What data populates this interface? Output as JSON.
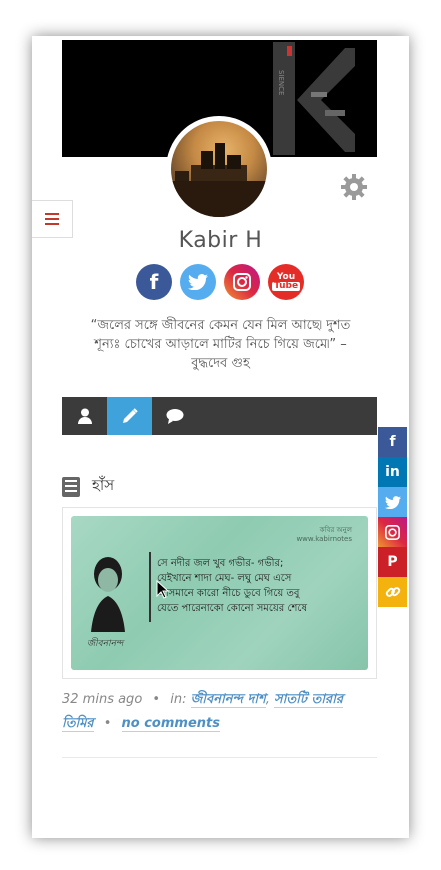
{
  "profile": {
    "name": "Kabir H",
    "quote": "“জলের সঙ্গে জীবনের কেমন যেন মিল আছে৷ দুশত শূন্যঃ চোখের আড়ালে মাটির নিচে গিয়ে জমে৷” – বুদ্ধদেব গুহ"
  },
  "socials": [
    {
      "name": "facebook-icon",
      "color": "#3b5998",
      "glyph": "f"
    },
    {
      "name": "twitter-icon",
      "color": "#55acee",
      "glyph": "t"
    },
    {
      "name": "instagram-icon",
      "color": "#c13584",
      "glyph": "◎"
    },
    {
      "name": "youtube-icon",
      "color": "#e52d27",
      "glyph": "You Tube"
    }
  ],
  "tabs": [
    {
      "name": "tab-profile",
      "icon": "user-icon"
    },
    {
      "name": "tab-posts",
      "icon": "pencil-icon",
      "active": true
    },
    {
      "name": "tab-comments",
      "icon": "comment-icon"
    }
  ],
  "post": {
    "title": "হাঁস",
    "image_text": {
      "lines": [
        "সে নদীর জল খুব গভীর- গভীর;",
        "যেইখানে শাদা মেঘ- লঘু মেঘ এসে",
        "আসমানে কারো নীচে ডুবে গিয়ে তবু",
        "যেতে পারেনাকো কোনো সময়ের শেষে"
      ],
      "poet": "জীবনানন্দ",
      "watermark": "কবির অনুল\nwww.kabirnotes"
    },
    "time": "32 mins ago",
    "in_label": "in:",
    "categories": [
      "জীবনানন্দ দাশ",
      "সাতটি তারার তিমির"
    ],
    "comments": "no comments"
  },
  "share_bar": [
    {
      "name": "facebook-share-icon",
      "color": "#3b5998",
      "glyph": "f"
    },
    {
      "name": "linkedin-share-icon",
      "color": "#0077b5",
      "glyph": "in"
    },
    {
      "name": "twitter-share-icon",
      "color": "#55acee",
      "glyph": "t"
    },
    {
      "name": "instagram-share-icon",
      "color": "#c13584",
      "glyph": "◎"
    },
    {
      "name": "pinterest-share-icon",
      "color": "#cb2027",
      "glyph": "P"
    },
    {
      "name": "copy-link-icon",
      "color": "#f4b20e",
      "glyph": "⛓"
    }
  ]
}
